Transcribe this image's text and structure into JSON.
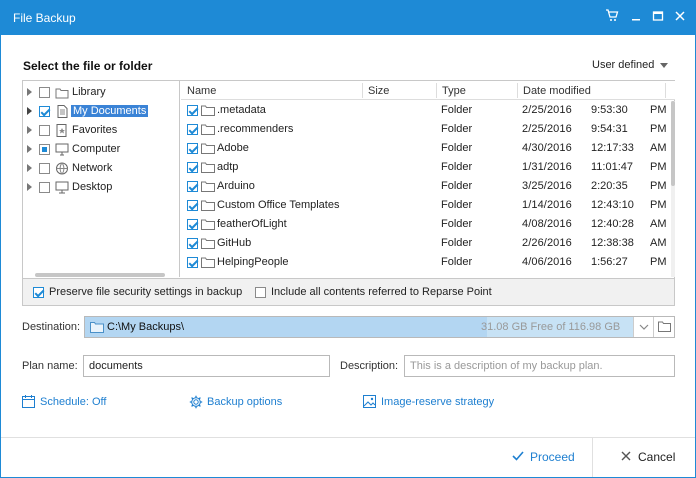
{
  "window": {
    "title": "File Backup"
  },
  "titlebar_icons": [
    "cart-icon",
    "minimize-icon",
    "maximize-icon",
    "close-icon"
  ],
  "section_title": "Select the file or folder",
  "view_mode": "User defined",
  "tree": [
    {
      "label": "Library",
      "icon": "library-icon",
      "checked": false,
      "partial": false,
      "selected": false
    },
    {
      "label": "My Documents",
      "icon": "document-icon",
      "checked": true,
      "partial": false,
      "selected": true
    },
    {
      "label": "Favorites",
      "icon": "favorites-icon",
      "checked": false,
      "partial": false,
      "selected": false
    },
    {
      "label": "Computer",
      "icon": "computer-icon",
      "checked": false,
      "partial": true,
      "selected": false
    },
    {
      "label": "Network",
      "icon": "network-icon",
      "checked": false,
      "partial": false,
      "selected": false
    },
    {
      "label": "Desktop",
      "icon": "desktop-icon",
      "checked": false,
      "partial": false,
      "selected": false
    }
  ],
  "columns": {
    "name": "Name",
    "size": "Size",
    "type": "Type",
    "date": "Date modified"
  },
  "files": [
    {
      "name": ".metadata",
      "type": "Folder",
      "date": "2/25/2016",
      "time": "9:53:30",
      "ampm": "PM"
    },
    {
      "name": ".recommenders",
      "type": "Folder",
      "date": "2/25/2016",
      "time": "9:54:31",
      "ampm": "PM"
    },
    {
      "name": "Adobe",
      "type": "Folder",
      "date": "4/30/2016",
      "time": "12:17:33",
      "ampm": "AM"
    },
    {
      "name": "adtp",
      "type": "Folder",
      "date": "1/31/2016",
      "time": "11:01:47",
      "ampm": "PM"
    },
    {
      "name": "Arduino",
      "type": "Folder",
      "date": "3/25/2016",
      "time": "2:20:35",
      "ampm": "PM"
    },
    {
      "name": "Custom Office Templates",
      "type": "Folder",
      "date": "1/14/2016",
      "time": "12:43:10",
      "ampm": "PM"
    },
    {
      "name": "featherOfLight",
      "type": "Folder",
      "date": "4/08/2016",
      "time": "12:40:28",
      "ampm": "AM"
    },
    {
      "name": "GitHub",
      "type": "Folder",
      "date": "2/26/2016",
      "time": "12:38:38",
      "ampm": "AM"
    },
    {
      "name": "HelpingPeople",
      "type": "Folder",
      "date": "4/06/2016",
      "time": "1:56:27",
      "ampm": "PM"
    }
  ],
  "options": {
    "preserve_security": {
      "label": "Preserve file security settings in backup",
      "checked": true
    },
    "reparse_point": {
      "label": "Include all contents referred to Reparse Point",
      "checked": false
    }
  },
  "destination": {
    "label": "Destination:",
    "path": "C:\\My Backups\\",
    "free_space": "31.08 GB Free of 116.98 GB",
    "used_fraction": 0.734
  },
  "plan": {
    "label": "Plan name:",
    "value": "documents"
  },
  "description": {
    "label": "Description:",
    "placeholder": "This is a description of my backup plan."
  },
  "links": {
    "schedule": "Schedule: Off",
    "backup_options": "Backup options",
    "image_reserve": "Image-reserve strategy"
  },
  "buttons": {
    "proceed": "Proceed",
    "cancel": "Cancel"
  },
  "colors": {
    "accent": "#1e8ad6",
    "link": "#1e7fd0"
  }
}
